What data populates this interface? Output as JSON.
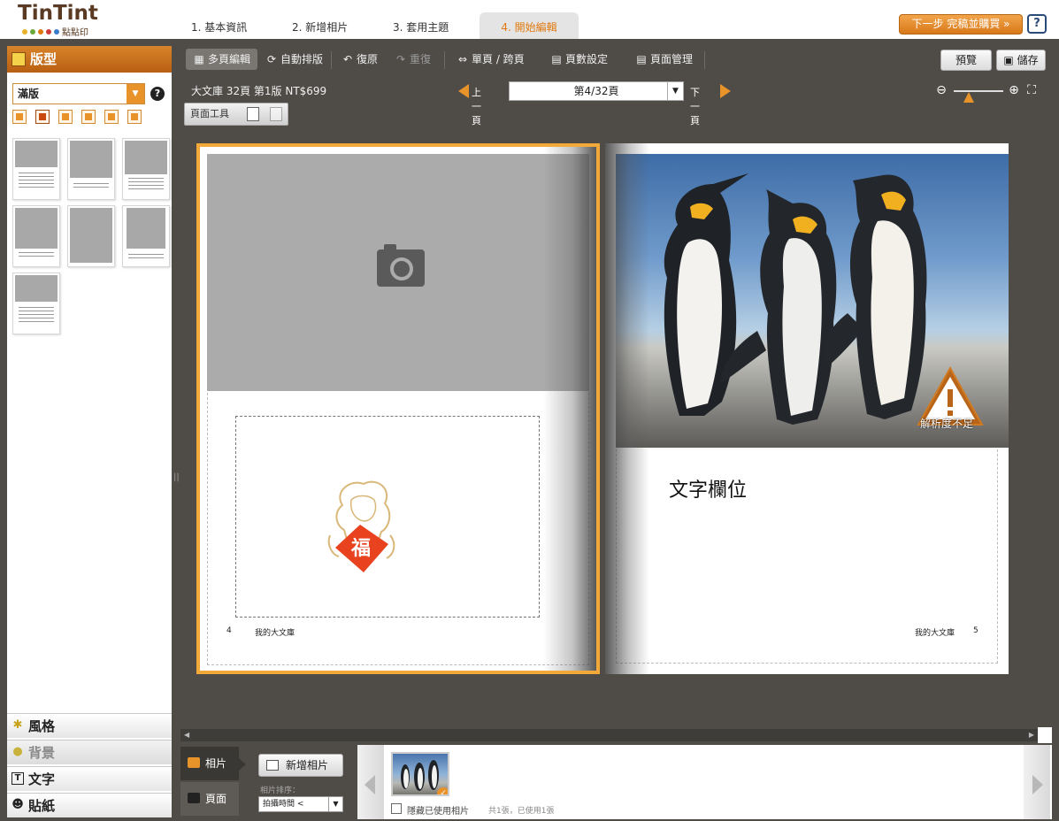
{
  "app": {
    "logo_main": "TinTint",
    "logo_sub": "點點印",
    "logo_dot_colors": [
      "#e8b22a",
      "#6aa83a",
      "#e07a10",
      "#cf3a3a",
      "#3a7ac8"
    ]
  },
  "steps": [
    {
      "label": "1. 基本資訊"
    },
    {
      "label": "2. 新增相片"
    },
    {
      "label": "3. 套用主題"
    },
    {
      "label": "4. 開始編輯"
    }
  ],
  "header": {
    "next_label": "下一步 完稿並購買 »",
    "help": "?"
  },
  "toolbar": {
    "multi_edit": "多頁編輯",
    "auto_layout": "自動排版",
    "undo": "復原",
    "redo": "重復",
    "single_spread": "單頁 / 跨頁",
    "page_count": "頁數設定",
    "page_manage": "頁面管理",
    "preview": "預覽",
    "save": "儲存"
  },
  "left_panel": {
    "title": "版型",
    "select_value": "滿版",
    "help": "?",
    "sections": [
      {
        "label": "風格"
      },
      {
        "label": "背景"
      },
      {
        "label": "文字"
      },
      {
        "label": "貼紙"
      }
    ]
  },
  "book": {
    "info": "大文庫 32頁 第1版 NT$699",
    "prev": "上一頁",
    "next": "下一頁",
    "current_page": "第4/32頁",
    "page_tools": "頁面工具",
    "zoom_level": 0.3
  },
  "spread": {
    "left_page_no": "4",
    "left_footer": "我的大文庫",
    "right_page_no": "5",
    "right_footer": "我的大文庫",
    "sticker_char": "福",
    "warning": "解析度不足",
    "text_field": "文字欄位"
  },
  "bottom": {
    "tab_photos": "相片",
    "tab_pages": "頁面",
    "add_photo": "新增相片",
    "sort_label": "相片排序：",
    "sort_value": "拍攝時間 <",
    "hide_used": "隱藏已使用相片",
    "count": "共1張，已使用1張"
  },
  "colors": {
    "accent": "#e8922a",
    "frame": "#4f4c48",
    "selection": "#f2a93a"
  }
}
